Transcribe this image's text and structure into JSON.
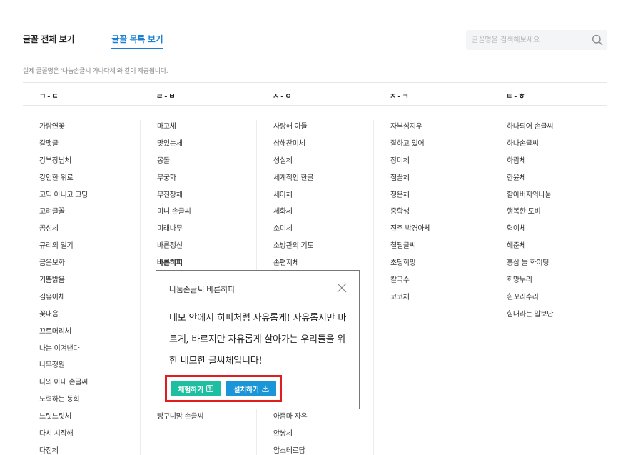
{
  "tabs": [
    {
      "label": "글꼴 전체 보기",
      "active": false
    },
    {
      "label": "글꼴 목록 보기",
      "active": true
    }
  ],
  "search": {
    "placeholder": "글꼴명을 검색해보세요",
    "icon": "search-icon"
  },
  "notice": "실제 글꼴명은 '나눔손글씨 가나다체'와 같이 제공됩니다.",
  "columns": [
    {
      "header": "ㄱ-ㄷ",
      "items": [
        "가람연꽃",
        "갈맷글",
        "강부장님체",
        "강인한 위로",
        "고딕 아니고 고딩",
        "고려글꼴",
        "곰신체",
        "규리의 일기",
        "금은보화",
        "기쁨밝음",
        "김유이체",
        "꽃내음",
        "끄트머리체",
        "나는 이겨낸다",
        "나무정원",
        "나의 아내 손글씨",
        "노력하는 동희",
        "느릿느릿체",
        "다시 시작해",
        "다진체"
      ]
    },
    {
      "header": "ㄹ-ㅂ",
      "items": [
        "마고체",
        "맛있는체",
        "몽돌",
        "무궁화",
        "무진장체",
        "미니 손글씨",
        "미래나무",
        "바른정신",
        "바른히피",
        "",
        "",
        "",
        "",
        "",
        "",
        "",
        "",
        "빵구니맘 손글씨"
      ],
      "bold_index": 8
    },
    {
      "header": "ㅅ-ㅇ",
      "items": [
        "사랑해 아들",
        "상해찬미체",
        "성실체",
        "세계적인 한글",
        "세아체",
        "세화체",
        "소미체",
        "소방관의 기도",
        "손편지체",
        "",
        "",
        "",
        "",
        "",
        "",
        "",
        "",
        "아줌마 자유",
        "안쌍체",
        "암스테르담"
      ]
    },
    {
      "header": "ㅈ-ㅋ",
      "items": [
        "자부심지우",
        "잘하고 있어",
        "장미체",
        "점꼴체",
        "정은체",
        "중학생",
        "진주 박경아체",
        "철필글씨",
        "초딩희망",
        "칼국수",
        "코코체"
      ]
    },
    {
      "header": "ㅌ-ㅎ",
      "items": [
        "하나되어 손글씨",
        "하나손글씨",
        "하람체",
        "한윤체",
        "할아버지의나눔",
        "행복한 도비",
        "혁이체",
        "혜준체",
        "홍삼 늘 화이팅",
        "희망누리",
        "흰꼬리수리",
        "힘내라는 말보단"
      ]
    }
  ],
  "popup": {
    "title": "나눔손글씨 바른히피",
    "sample": "네모 안에서 히피처럼 자유롭게! 자유롭지만 바르게, 바르지만 자유롭게 살아가는 우리들을 위한 네모한 글씨체입니다!",
    "try_label": "체험하기",
    "install_label": "설치하기"
  },
  "colors": {
    "accent": "#1a7fd4",
    "try_button": "#1dbfa0",
    "install_button": "#1a95d8",
    "highlight": "#e11d1d"
  }
}
